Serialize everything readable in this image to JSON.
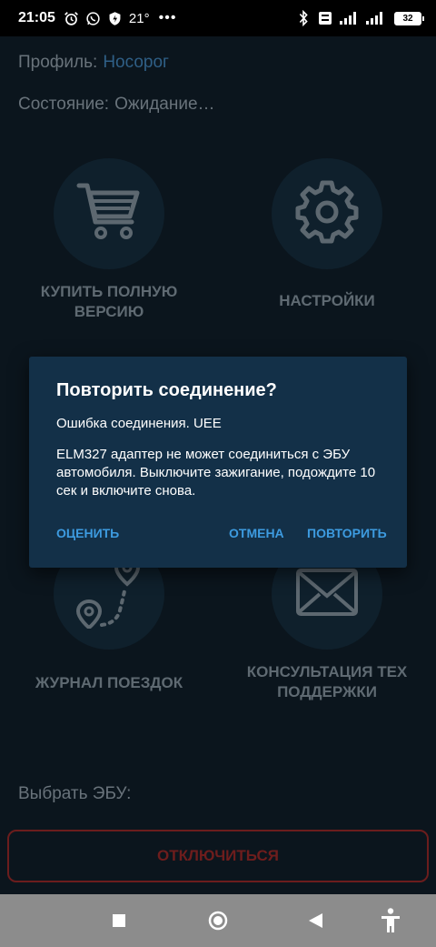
{
  "status_bar": {
    "time": "21:05",
    "temperature": "21°",
    "overflow": "•••",
    "battery": "32",
    "icons": [
      "alarm-icon",
      "whatsapp-icon",
      "shield-icon",
      "bluetooth-icon",
      "volte-icon",
      "signal-icon",
      "4g-signal-icon",
      "battery-icon"
    ]
  },
  "profile": {
    "label": "Профиль:",
    "value": "Носорог"
  },
  "state": {
    "label": "Состояние:",
    "value": "Ожидание…"
  },
  "tiles": [
    {
      "id": "buy",
      "icon": "cart-icon",
      "label_line1": "КУПИТЬ ПОЛНУЮ",
      "label_line2": "ВЕРСИЮ"
    },
    {
      "id": "settings",
      "icon": "gear-icon",
      "label_line1": "НАСТРОЙКИ",
      "label_line2": ""
    },
    {
      "id": "trips",
      "icon": "route-icon",
      "label_line1": "ЖУРНАЛ ПОЕЗДОК",
      "label_line2": ""
    },
    {
      "id": "support",
      "icon": "mail-icon",
      "label_line1": "КОНСУЛЬТАЦИЯ ТЕХ",
      "label_line2": "ПОДДЕРЖКИ"
    }
  ],
  "select_ecu": "Выбрать ЭБУ:",
  "disconnect_label": "ОТКЛЮЧИТЬСЯ",
  "dialog": {
    "title": "Повторить соединение?",
    "error_line": "Ошибка соединения. UEE",
    "message": "ELM327 адаптер не может соединиться с ЭБУ автомобиля. Выключите зажигание, подождите 10 сек и включите снова.",
    "rate_button": "ОЦЕНИТЬ",
    "cancel_button": "ОТМЕНА",
    "retry_button": "ПОВТОРИТЬ"
  },
  "nav": {
    "icons": [
      "recents-icon",
      "home-icon",
      "back-icon",
      "accessibility-icon"
    ]
  },
  "colors": {
    "background": "#0b151d",
    "dialog": "#133048",
    "accent": "#3d9be0",
    "danger": "#6e1d1d",
    "profile_value": "#2f5f86"
  }
}
